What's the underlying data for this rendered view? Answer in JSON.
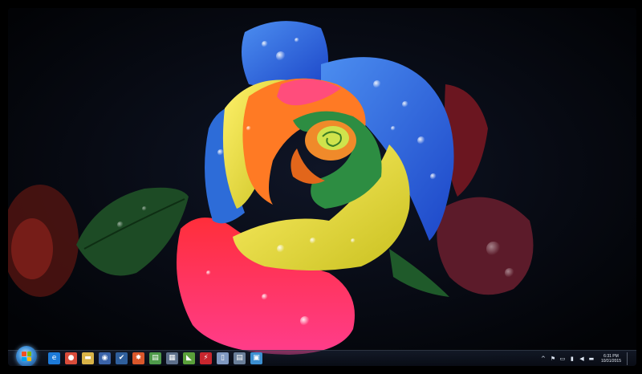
{
  "taskbar": {
    "start_button": {
      "icon": "windows-orb-icon"
    },
    "pinned": [
      {
        "name": "taskbar-ie-icon",
        "glyph": "e",
        "color": "#1d7ad8"
      },
      {
        "name": "taskbar-chrome-icon",
        "glyph": "●",
        "color": "#d94c3a"
      },
      {
        "name": "taskbar-explorer-icon",
        "glyph": "▬",
        "color": "#d8b347"
      },
      {
        "name": "taskbar-app-icon-4",
        "glyph": "◉",
        "color": "#3a63a8"
      },
      {
        "name": "taskbar-app-icon-5",
        "glyph": "✔",
        "color": "#2f5f9c"
      },
      {
        "name": "taskbar-app-icon-6",
        "glyph": "✸",
        "color": "#d9572b"
      },
      {
        "name": "taskbar-app-icon-7",
        "glyph": "▤",
        "color": "#4e9a4a"
      },
      {
        "name": "taskbar-app-icon-8",
        "glyph": "▦",
        "color": "#5d6f8a"
      },
      {
        "name": "taskbar-app-icon-9",
        "glyph": "◣",
        "color": "#5aa03a"
      },
      {
        "name": "taskbar-app-icon-10",
        "glyph": "⚡",
        "color": "#c8262e"
      },
      {
        "name": "taskbar-app-icon-11",
        "glyph": "▯",
        "color": "#7f98c0"
      },
      {
        "name": "taskbar-app-icon-12",
        "glyph": "▤",
        "color": "#6a7f99"
      },
      {
        "name": "taskbar-app-icon-13",
        "glyph": "▣",
        "color": "#3c8fd0"
      }
    ],
    "tray": {
      "icons": [
        "chevron-up-icon",
        "flag-icon",
        "monitor-icon",
        "network-icon",
        "volume-icon",
        "keyboard-icon"
      ],
      "time": "6:31 PM",
      "date": "10/31/2015"
    }
  }
}
